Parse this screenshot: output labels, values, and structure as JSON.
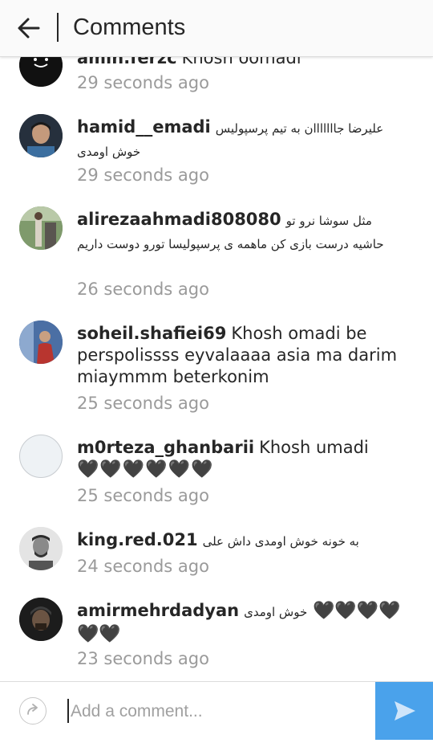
{
  "header": {
    "title": "Comments",
    "back_icon": "arrow-left-icon"
  },
  "comments": [
    {
      "username": "amin.ferzc",
      "text": "Khosh oomadi",
      "time": "29 seconds ago"
    },
    {
      "username": "hamid__emadi",
      "text": "علیرضا جااااااان به تیم پرسپولیس خوش اومدی",
      "time": "29 seconds ago"
    },
    {
      "username": "alirezaahmadi808080",
      "text": "مثل سوشا نرو تو حاشیه درست بازی کن ماهمه ی پرسپولیسا تورو دوست داریم",
      "time": "26 seconds ago"
    },
    {
      "username": "soheil.shafiei69",
      "text": "Khosh omadi be perspolissss eyvalaaaa asia ma darim miaymmm beterkonim",
      "time": "25 seconds ago"
    },
    {
      "username": "m0rteza_ghanbarii",
      "text": "Khosh umadi",
      "hearts": "🖤🖤🖤🖤🖤🖤",
      "time": "25 seconds ago"
    },
    {
      "username": "king.red.021",
      "text": "به خونه خوش اومدی داش علی",
      "time": "24 seconds ago"
    },
    {
      "username": "amirmehrdadyan",
      "text": "خوش اومدی",
      "hearts": "🖤🖤🖤🖤🖤🖤",
      "time": "23 seconds ago"
    }
  ],
  "footer": {
    "placeholder": "Add a comment...",
    "reply_icon": "reply-arrow-icon",
    "send_icon": "send-icon"
  },
  "colors": {
    "send_button": "#4aa2eb",
    "timestamp": "#9a9a9a",
    "text": "#262626"
  }
}
